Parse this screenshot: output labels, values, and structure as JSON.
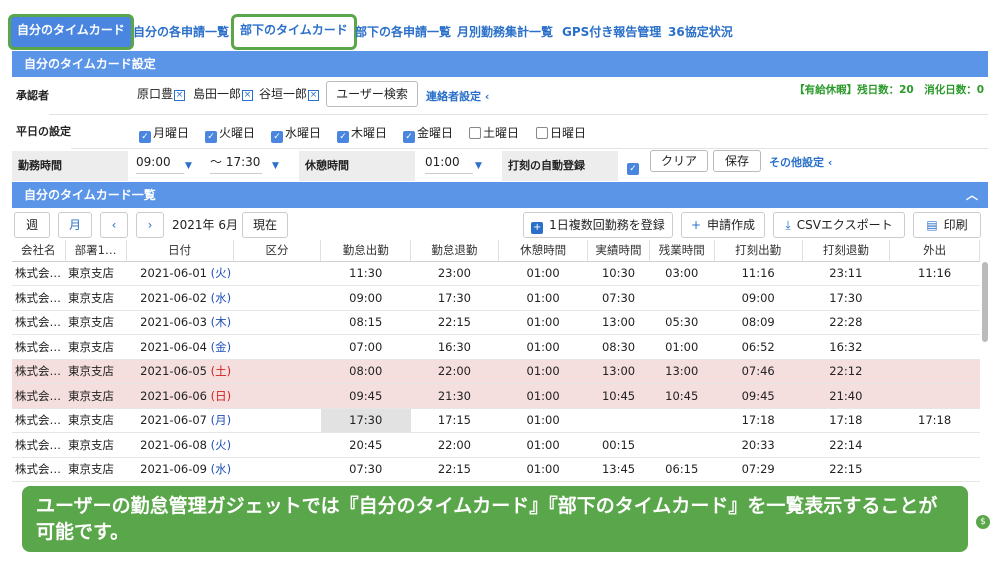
{
  "tabs": [
    {
      "label": "自分のタイムカード"
    },
    {
      "label": "自分の各申請一覧"
    },
    {
      "label": "部下のタイムカード"
    },
    {
      "label": "部下の各申請一覧"
    },
    {
      "label": "月別勤務集計一覧"
    },
    {
      "label": "GPS付き報告管理"
    },
    {
      "label": "36協定状況"
    }
  ],
  "settings": {
    "title": "自分のタイムカード設定",
    "approver_label": "承認者",
    "approvers": [
      "原口豊",
      "島田一郎",
      "谷垣一郎"
    ],
    "user_search": "ユーザー検索",
    "contact_settings": "連絡者設定 ‹",
    "leave_info": "【有給休暇】残日数：20　消化日数：0",
    "weekday_label": "平日の設定",
    "weekdays": [
      {
        "label": "月曜日",
        "checked": true
      },
      {
        "label": "火曜日",
        "checked": true
      },
      {
        "label": "水曜日",
        "checked": true
      },
      {
        "label": "木曜日",
        "checked": true
      },
      {
        "label": "金曜日",
        "checked": true
      },
      {
        "label": "土曜日",
        "checked": false
      },
      {
        "label": "日曜日",
        "checked": false
      }
    ],
    "work_time_label": "勤務時間",
    "work_start": "09:00",
    "work_tilde": "〜 17:30",
    "break_label": "休憩時間",
    "break_time": "01:00",
    "auto_register_label": "打刻の自動登録",
    "clear": "クリア",
    "save": "保存",
    "other_settings": "その他設定 ‹"
  },
  "list": {
    "title": "自分のタイムカード一覧",
    "collapse_icon": "chevron-up-icon",
    "week": "週",
    "month": "月",
    "prev": "‹",
    "next": "›",
    "period": "2021年 6月",
    "now": "現在",
    "multi_register": "1日複数回勤務を登録",
    "apply": "申請作成",
    "csv_export": "CSVエクスポート",
    "print": "印刷",
    "columns": [
      "会社名",
      "部署1…",
      "日付",
      "区分",
      "勤怠出勤",
      "勤怠退勤",
      "休憩時間",
      "実績時間",
      "残業時間",
      "打刻出勤",
      "打刻退勤",
      "外出"
    ],
    "rows": [
      {
        "company": "株式会…",
        "dept": "東京支店",
        "date": "2021-06-01",
        "dow": "火",
        "type": "",
        "in": "11:30",
        "out": "23:00",
        "break": "01:00",
        "actual": "10:30",
        "overtime": "03:00",
        "stamp_in": "11:16",
        "stamp_out": "23:11",
        "outing": "11:16"
      },
      {
        "company": "株式会…",
        "dept": "東京支店",
        "date": "2021-06-02",
        "dow": "水",
        "type": "",
        "in": "09:00",
        "out": "17:30",
        "break": "01:00",
        "actual": "07:30",
        "overtime": "",
        "stamp_in": "09:00",
        "stamp_out": "17:30",
        "outing": ""
      },
      {
        "company": "株式会…",
        "dept": "東京支店",
        "date": "2021-06-03",
        "dow": "木",
        "type": "",
        "in": "08:15",
        "out": "22:15",
        "break": "01:00",
        "actual": "13:00",
        "overtime": "05:30",
        "stamp_in": "08:09",
        "stamp_out": "22:28",
        "outing": ""
      },
      {
        "company": "株式会…",
        "dept": "東京支店",
        "date": "2021-06-04",
        "dow": "金",
        "type": "",
        "in": "07:00",
        "out": "16:30",
        "break": "01:00",
        "actual": "08:30",
        "overtime": "01:00",
        "stamp_in": "06:52",
        "stamp_out": "16:32",
        "outing": ""
      },
      {
        "company": "株式会…",
        "dept": "東京支店",
        "date": "2021-06-05",
        "dow": "土",
        "type": "",
        "in": "08:00",
        "out": "22:00",
        "break": "01:00",
        "actual": "13:00",
        "overtime": "13:00",
        "stamp_in": "07:46",
        "stamp_out": "22:12",
        "outing": "",
        "weekend": true
      },
      {
        "company": "株式会…",
        "dept": "東京支店",
        "date": "2021-06-06",
        "dow": "日",
        "type": "",
        "in": "09:45",
        "out": "21:30",
        "break": "01:00",
        "actual": "10:45",
        "overtime": "10:45",
        "stamp_in": "09:45",
        "stamp_out": "21:40",
        "outing": "",
        "weekend": true
      },
      {
        "company": "株式会…",
        "dept": "東京支店",
        "date": "2021-06-07",
        "dow": "月",
        "type": "",
        "in": "17:30",
        "out": "17:15",
        "break": "01:00",
        "actual": "",
        "overtime": "",
        "stamp_in": "17:18",
        "stamp_out": "17:18",
        "outing": "17:18",
        "grey_in": true
      },
      {
        "company": "株式会…",
        "dept": "東京支店",
        "date": "2021-06-08",
        "dow": "火",
        "type": "",
        "in": "20:45",
        "out": "22:00",
        "break": "01:00",
        "actual": "00:15",
        "overtime": "",
        "stamp_in": "20:33",
        "stamp_out": "22:14",
        "outing": ""
      },
      {
        "company": "株式会…",
        "dept": "東京支店",
        "date": "2021-06-09",
        "dow": "水",
        "type": "",
        "in": "07:30",
        "out": "22:15",
        "break": "01:00",
        "actual": "13:45",
        "overtime": "06:15",
        "stamp_in": "07:29",
        "stamp_out": "22:15",
        "outing": ""
      }
    ]
  },
  "overlay": {
    "text": "ユーザーの勤怠管理ガジェットでは『自分のタイムカード』『部下のタイムカード』を一覧表示することが可能です。"
  },
  "colors": {
    "accent": "#5b95e8",
    "green": "#5aa64a",
    "weekend_row": "#f5dede"
  }
}
